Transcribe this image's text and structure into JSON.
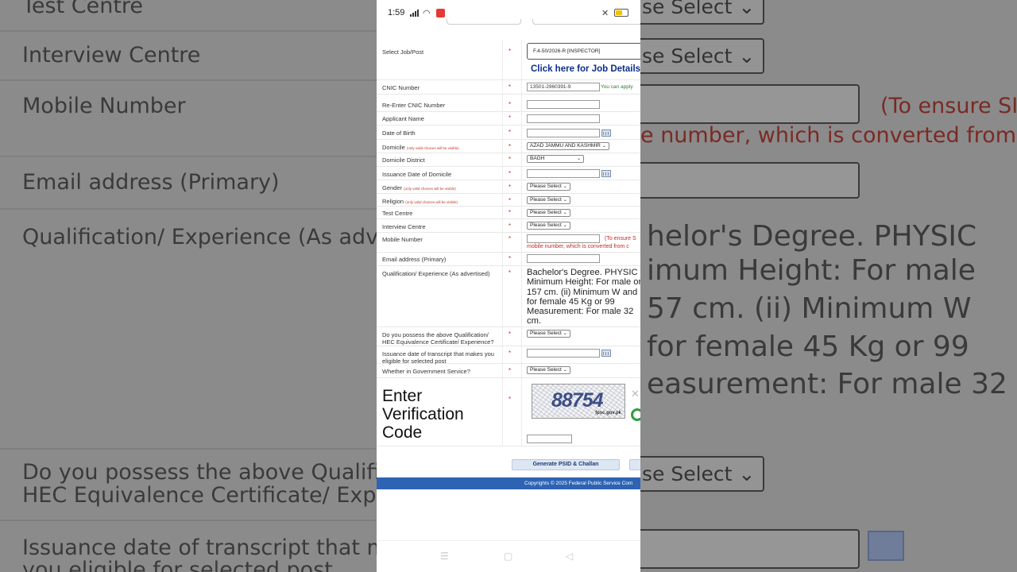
{
  "status_bar": {
    "time": "1:59"
  },
  "form": {
    "job": {
      "label": "Select Job/Post",
      "value": "F.4-50/2026-R [INSPECTOR]",
      "details_link": "Click here for Job Details"
    },
    "cnic": {
      "label": "CNIC Number",
      "value": "13501-2960391-9",
      "hint": "You can apply"
    },
    "re_cnic": {
      "label": "Re-Enter CNIC Number"
    },
    "applicant_name": {
      "label": "Applicant Name"
    },
    "dob": {
      "label": "Date of Birth"
    },
    "domicile": {
      "label": "Domicile",
      "note": "(only valid choices will be visible)",
      "value": "AZAD JAMMU AND KASHMIR"
    },
    "domicile_district": {
      "label": "Domicile District",
      "value": "BAGH"
    },
    "domicile_date": {
      "label": "Issuance Date of Domicile"
    },
    "gender": {
      "label": "Gender",
      "note": "(only valid choices will be visible)",
      "value": "Please Select"
    },
    "religion": {
      "label": "Religion",
      "note": "(only valid choices will be visible)",
      "value": "Please Select"
    },
    "test_centre": {
      "label": "Test Centre",
      "value": "Please Select"
    },
    "interview_centre": {
      "label": "Interview Centre",
      "value": "Please Select"
    },
    "mobile": {
      "label": "Mobile Number",
      "hint1": "(To ensure S",
      "hint2": "mobile number, which is converted from c"
    },
    "email": {
      "label": "Email address (Primary)"
    },
    "qualification": {
      "label": "Qualification/ Experience (As advertised)",
      "text": "Bachelor's Degree. PHYSIC Minimum Height: For male or 157 cm. (ii) Minimum W and for female 45 Kg or 99 Measurement: For male 32 cm."
    },
    "hec": {
      "label": "Do you possess the above Qualification/ HEC Equivalence Certificate/ Experience?",
      "value": "Please Select"
    },
    "transcript_date": {
      "label": "Issuance date of transcript that makes you eligible for selected post"
    },
    "govt_service": {
      "label": "Whether in Government Service?",
      "value": "Please Select"
    },
    "verification": {
      "label": "Enter Verification Code",
      "captcha_code": "88754",
      "captcha_domain": "fpsc.gov.pk"
    },
    "required_mark": "*"
  },
  "actions": {
    "generate": "Generate PSID & Challan"
  },
  "footer": {
    "text": "Copyrights © 2025 Federal Public Service Com"
  },
  "background": {
    "left": {
      "test_centre": "Test Centre",
      "interview_centre": "Interview Centre",
      "mobile": "Mobile Number",
      "email": "Email address (Primary)",
      "qualification": "Qualification/ Experience (As adve",
      "hec1": "Do you possess the above Qualific",
      "hec2": "HEC Equivalence Certificate/ Expe",
      "transcript1": "Issuance date of transcript that m",
      "transcript2": "you eligible for selected post"
    },
    "right": {
      "sel1": "se Select",
      "sel2": "se Select",
      "hint1": "(To ensure SI",
      "hint2": "e number, which is converted from c",
      "q1": "helor's Degree. PHYSIC",
      "q2": "imum Height: For male",
      "q3": "57 cm. (ii) Minimum W",
      "q4": "for female 45 Kg or 99",
      "q5": "easurement: For male 32",
      "sel3": "se Select"
    }
  }
}
